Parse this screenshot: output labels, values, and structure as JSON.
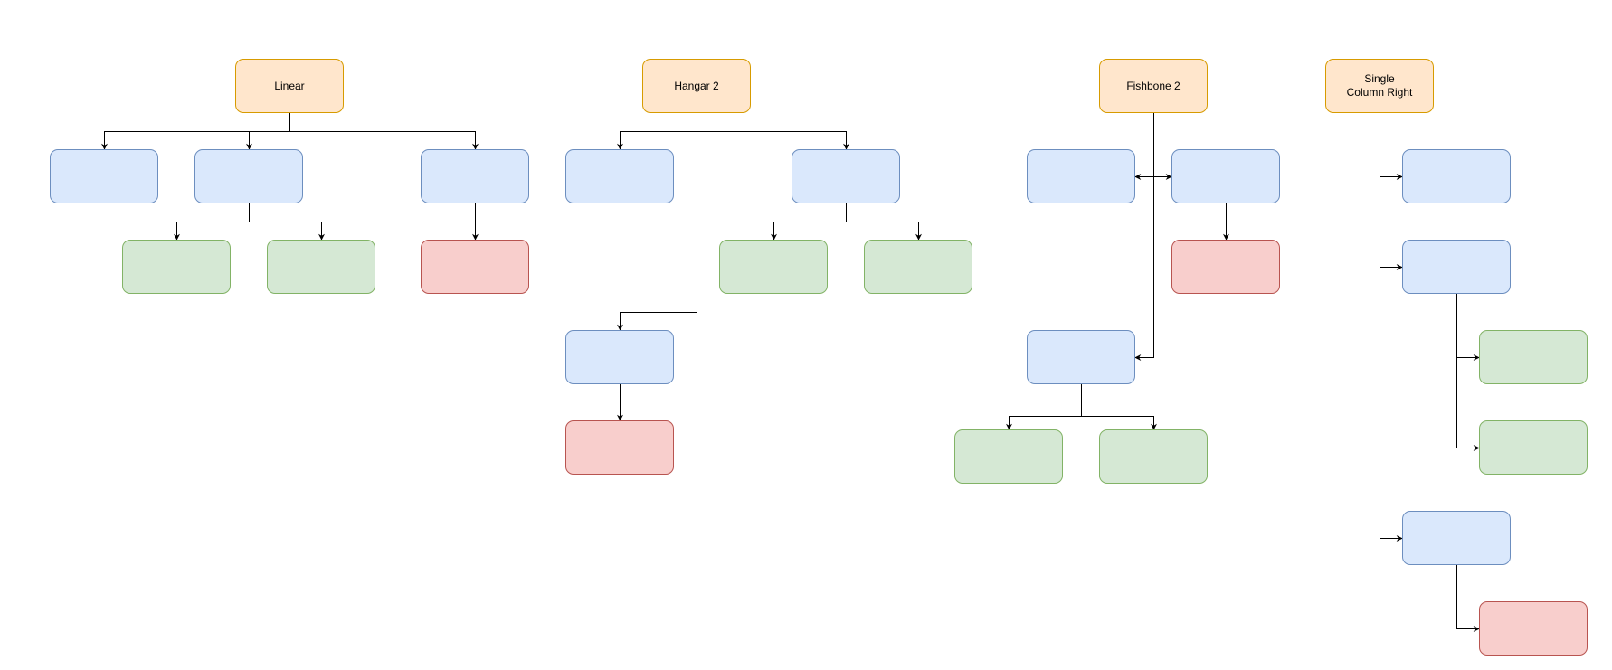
{
  "diagram": {
    "colors": {
      "root_fill": "#ffe6cc",
      "root_stroke": "#d79b00",
      "blue_fill": "#dae8fc",
      "blue_stroke": "#6c8ebf",
      "green_fill": "#d5e8d4",
      "green_stroke": "#82b366",
      "red_fill": "#f8cecc",
      "red_stroke": "#b85450",
      "edge": "#000000"
    },
    "trees": [
      {
        "name": "linear",
        "title": "Linear",
        "layout": "vertical-tree",
        "children": [
          {
            "kind": "blue",
            "children": []
          },
          {
            "kind": "blue",
            "children": [
              {
                "kind": "green"
              },
              {
                "kind": "green"
              }
            ]
          },
          {
            "kind": "blue",
            "children": [
              {
                "kind": "red"
              }
            ]
          }
        ]
      },
      {
        "name": "hangar-2",
        "title": "Hangar 2",
        "layout": "hangar",
        "children": [
          {
            "kind": "blue",
            "children": []
          },
          {
            "kind": "blue",
            "children": [
              {
                "kind": "green"
              },
              {
                "kind": "green"
              }
            ]
          },
          {
            "kind": "blue",
            "children": [
              {
                "kind": "red"
              }
            ]
          }
        ]
      },
      {
        "name": "fishbone-2",
        "title": "Fishbone 2",
        "layout": "fishbone",
        "children": [
          {
            "kind": "blue",
            "children": []
          },
          {
            "kind": "blue",
            "children": [
              {
                "kind": "red"
              }
            ]
          },
          {
            "kind": "blue",
            "children": [
              {
                "kind": "green"
              },
              {
                "kind": "green"
              }
            ]
          }
        ]
      },
      {
        "name": "single-column-right",
        "title": "Single\nColumn Right",
        "layout": "single-column-right",
        "children": [
          {
            "kind": "blue",
            "children": []
          },
          {
            "kind": "blue",
            "children": [
              {
                "kind": "green"
              },
              {
                "kind": "green"
              }
            ]
          },
          {
            "kind": "blue",
            "children": [
              {
                "kind": "red"
              }
            ]
          }
        ]
      }
    ]
  }
}
